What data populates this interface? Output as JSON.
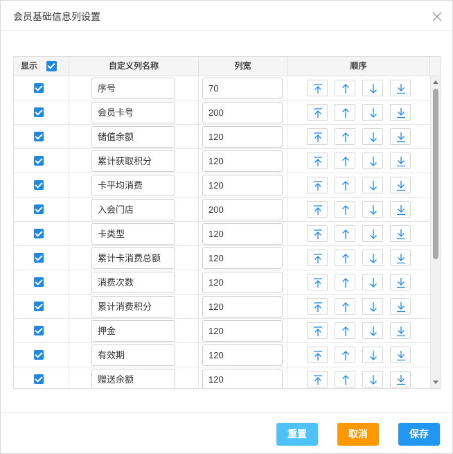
{
  "dialog": {
    "title": "会员基础信息列设置"
  },
  "table": {
    "headers": {
      "show": "显示",
      "name": "自定义列名称",
      "width": "列宽",
      "order": "顺序"
    },
    "rows": [
      {
        "name": "序号",
        "width": "70"
      },
      {
        "name": "会员卡号",
        "width": "200"
      },
      {
        "name": "储值余额",
        "width": "120"
      },
      {
        "name": "累计获取积分",
        "width": "120"
      },
      {
        "name": "卡平均消费",
        "width": "120"
      },
      {
        "name": "入会门店",
        "width": "200"
      },
      {
        "name": "卡类型",
        "width": "120"
      },
      {
        "name": "累计卡消费总额",
        "width": "120"
      },
      {
        "name": "消费次数",
        "width": "120"
      },
      {
        "name": "累计消费积分",
        "width": "120"
      },
      {
        "name": "押金",
        "width": "120"
      },
      {
        "name": "有效期",
        "width": "120"
      },
      {
        "name": "赠送余额",
        "width": "120"
      }
    ]
  },
  "footer": {
    "reset": "重置",
    "cancel": "取消",
    "save": "保存"
  },
  "colors": {
    "accent": "#1e88e5",
    "reset": "#4fc3f7",
    "cancel": "#ff9800",
    "save": "#2196f3"
  },
  "icons": {
    "close": "close-icon",
    "top": "move-top-icon",
    "up": "arrow-up-icon",
    "down": "arrow-down-icon",
    "bottom": "move-bottom-icon"
  }
}
